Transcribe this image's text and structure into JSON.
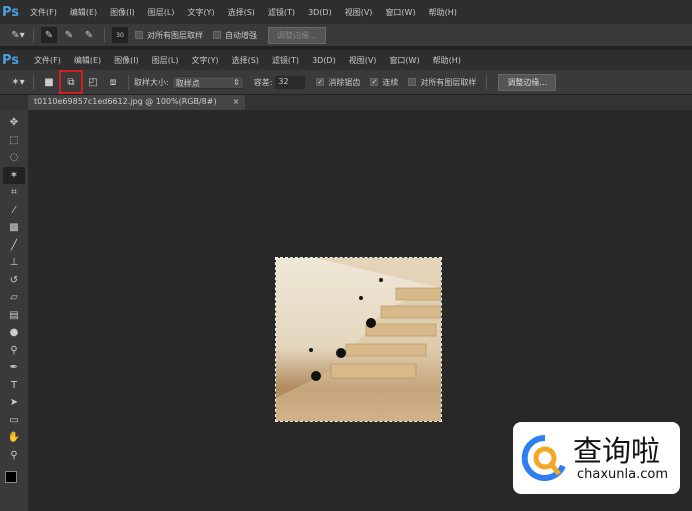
{
  "app": {
    "logo": "Ps"
  },
  "back_window": {
    "menu": [
      "文件(F)",
      "编辑(E)",
      "图像(I)",
      "图层(L)",
      "文字(Y)",
      "选择(S)",
      "滤镜(T)",
      "3D(D)",
      "视图(V)",
      "窗口(W)",
      "帮助(H)"
    ],
    "options": {
      "brush_size": "30",
      "sample_all_layers": "对所有图层取样",
      "auto_enhance": "自动增强",
      "refine_edge": "调整边缘..."
    }
  },
  "front_window": {
    "menu": [
      "文件(F)",
      "编辑(E)",
      "图像(I)",
      "图层(L)",
      "文字(Y)",
      "选择(S)",
      "滤镜(T)",
      "3D(D)",
      "视图(V)",
      "窗口(W)",
      "帮助(H)"
    ],
    "options": {
      "sample_size_label": "取样大小:",
      "sample_size_value": "取样点",
      "tolerance_label": "容差:",
      "tolerance_value": "32",
      "anti_alias": "消除锯齿",
      "anti_alias_checked": true,
      "contiguous": "连续",
      "contiguous_checked": true,
      "sample_all_layers": "对所有图层取样",
      "sample_all_layers_checked": false,
      "refine_edge": "调整边缘..."
    },
    "document_tab": {
      "title": "t0110e69857c1ed6612.jpg @ 100%(RGB/8#)",
      "close": "×"
    }
  },
  "tools": [
    "move",
    "marquee",
    "lasso",
    "magic-wand",
    "crop",
    "eyedropper",
    "healing",
    "brush",
    "clone-stamp",
    "history-brush",
    "eraser",
    "gradient",
    "blur",
    "dodge",
    "pen",
    "type",
    "path-selection",
    "rectangle",
    "hand",
    "zoom"
  ],
  "highlight_color": "#d02020",
  "watermark": {
    "name": "查询啦",
    "url": "chaxunla.com"
  }
}
